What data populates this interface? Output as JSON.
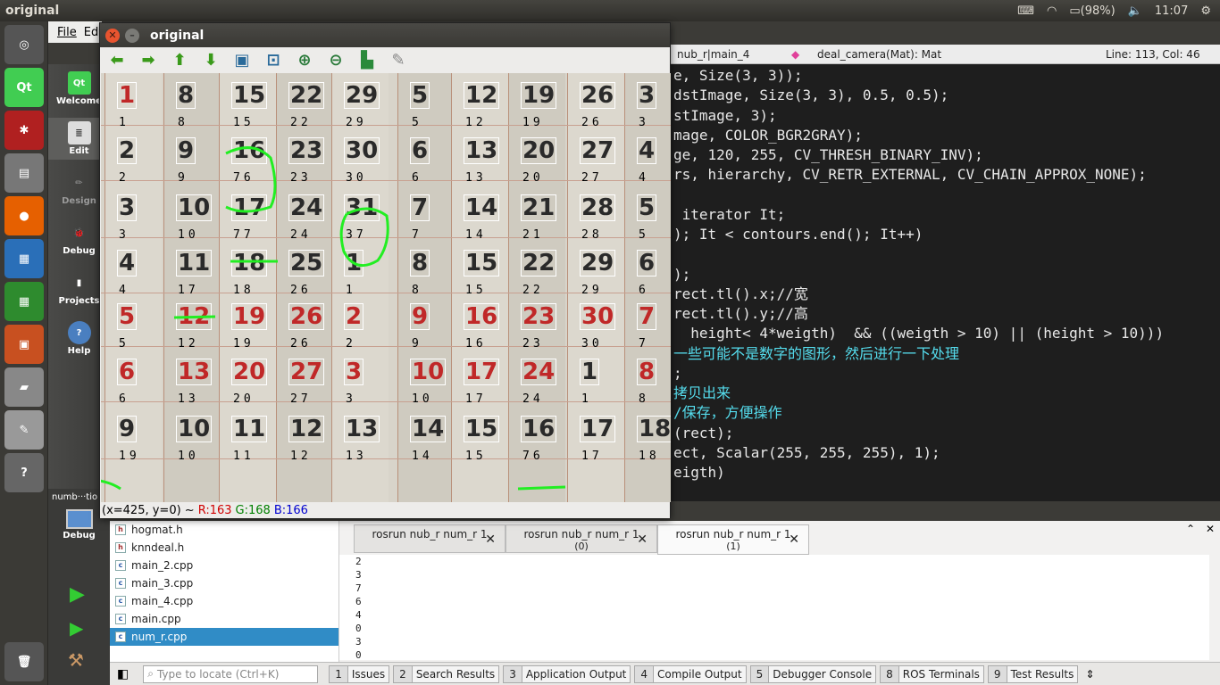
{
  "topbar": {
    "title": "original",
    "battery": "(98%)",
    "time": "11:07"
  },
  "menu": {
    "file": "File",
    "edit": "Ed"
  },
  "modes": [
    "Welcome",
    "Edit",
    "Design",
    "Debug",
    "Projects",
    "Help"
  ],
  "debug_pane": {
    "session": "numb···tio",
    "label": "Debug"
  },
  "editor_header": {
    "file": "nub_r|main_4",
    "function": "deal_camera(Mat): Mat",
    "position": "Line: 113, Col: 46"
  },
  "code_lines": [
    "e, Size(3, 3));",
    "dstImage, Size(3, 3), 0.5, 0.5);",
    "stImage, 3);",
    "mage, COLOR_BGR2GRAY);",
    "ge, 120, 255, CV_THRESH_BINARY_INV);",
    "rs, hierarchy, CV_RETR_EXTERNAL, CV_CHAIN_APPROX_NONE);",
    "",
    " iterator It;",
    "); It < contours.end(); It++)",
    "",
    ");",
    "rect.tl().x;//宽",
    "rect.tl().y;//高",
    "  height< 4*weigth)  && ((weigth > 10) || (height > 10)))",
    "一些可能不是数字的图形，然后进行一下处理",
    ";",
    "拷贝出来",
    "/保存，方便操作",
    "(rect);",
    "ect, Scalar(255, 255, 255), 1);",
    "eigth)"
  ],
  "project_files": [
    "hogmat.h",
    "knndeal.h",
    "main_2.cpp",
    "main_3.cpp",
    "main_4.cpp",
    "main.cpp",
    "num_r.cpp"
  ],
  "output_tabs": [
    {
      "label": "rosrun nub_r num_r 1",
      "sub": ""
    },
    {
      "label": "rosrun nub_r num_r 1",
      "sub": "(0)"
    },
    {
      "label": "rosrun nub_r num_r 1",
      "sub": "(1)"
    }
  ],
  "output_lines": [
    "2",
    "3",
    "7",
    "6",
    "4",
    "0",
    "3",
    "0"
  ],
  "statusbar": {
    "locator_placeholder": "Type to locate (Ctrl+K)",
    "panes": [
      {
        "n": "1",
        "label": "Issues"
      },
      {
        "n": "2",
        "label": "Search Results"
      },
      {
        "n": "3",
        "label": "Application Output"
      },
      {
        "n": "4",
        "label": "Compile Output"
      },
      {
        "n": "5",
        "label": "Debugger Console"
      },
      {
        "n": "8",
        "label": "ROS Terminals"
      },
      {
        "n": "9",
        "label": "Test Results"
      }
    ]
  },
  "image_window": {
    "title": "original",
    "status": {
      "coords": "(x=425, y=0) ~",
      "r": "R:163",
      "g": "G:168",
      "b": "B:166"
    }
  },
  "calendar": {
    "rows": [
      [
        "1",
        "8",
        "15",
        "22",
        "29",
        "5",
        "12",
        "19",
        "26",
        "3"
      ],
      [
        "2",
        "9",
        "16",
        "23",
        "30",
        "6",
        "13",
        "20",
        "27",
        "4"
      ],
      [
        "3",
        "10",
        "17",
        "24",
        "31",
        "7",
        "14",
        "21",
        "28",
        "5"
      ],
      [
        "4",
        "11",
        "18",
        "25",
        "1",
        "8",
        "15",
        "22",
        "29",
        "6"
      ],
      [
        "5",
        "12",
        "19",
        "26",
        "2",
        "9",
        "16",
        "23",
        "30",
        "7"
      ],
      [
        "6",
        "13",
        "20",
        "27",
        "3",
        "10",
        "17",
        "24",
        "1",
        "8"
      ],
      [
        "9",
        "10",
        "11",
        "12",
        "13",
        "14",
        "15",
        "16",
        "17",
        "18"
      ]
    ],
    "labels": [
      [
        "1",
        "8",
        "15",
        "22",
        "29",
        "5",
        "12",
        "19",
        "26",
        "3"
      ],
      [
        "2",
        "9",
        "76",
        "23",
        "30",
        "6",
        "13",
        "20",
        "27",
        "4"
      ],
      [
        "3",
        "10",
        "77",
        "24",
        "37",
        "7",
        "14",
        "21",
        "28",
        "5"
      ],
      [
        "4",
        "17",
        "18",
        "26",
        "1",
        "8",
        "15",
        "22",
        "29",
        "6"
      ],
      [
        "5",
        "12",
        "19",
        "26",
        "2",
        "9",
        "16",
        "23",
        "30",
        "7"
      ],
      [
        "6",
        "13",
        "20",
        "27",
        "3",
        "10",
        "17",
        "24",
        "1",
        "8"
      ],
      [
        "19",
        "10",
        "11",
        "12",
        "13",
        "14",
        "15",
        "76",
        "17",
        "18"
      ]
    ]
  },
  "colors": {
    "accent": "#308cc6",
    "red_digits": "#c02828",
    "circle": "#22ee22"
  }
}
